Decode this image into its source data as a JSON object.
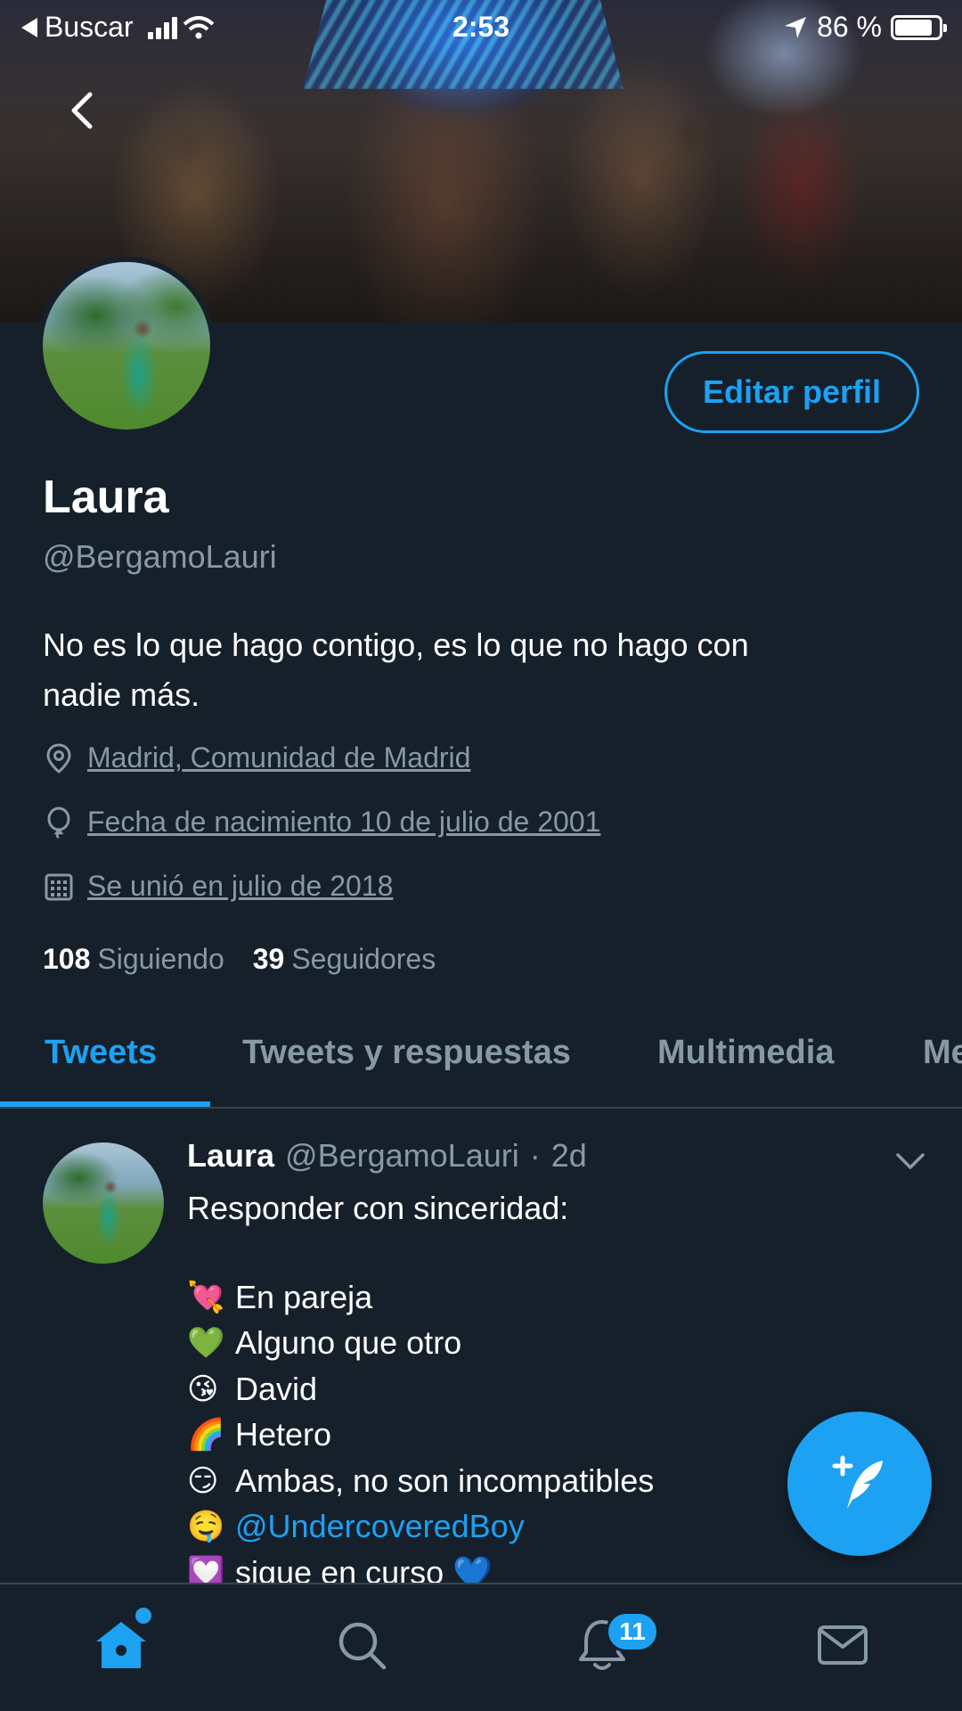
{
  "status_bar": {
    "back_app": "Buscar",
    "time": "2:53",
    "battery": "86 %",
    "battery_level": 0.86
  },
  "profile": {
    "edit_button": "Editar perfil",
    "name": "Laura",
    "handle": "@BergamoLauri",
    "bio_line1": "No es lo que hago contigo, es lo que no hago con",
    "bio_line2": "nadie más.",
    "location": "Madrid, Comunidad de Madrid",
    "birthday": "Fecha de nacimiento 10 de julio de 2001",
    "joined": "Se unió en julio de 2018",
    "following_count": "108",
    "following_label": "Siguiendo",
    "followers_count": "39",
    "followers_label": "Seguidores"
  },
  "tabs": [
    {
      "label": "Tweets",
      "active": true
    },
    {
      "label": "Tweets y respuestas",
      "active": false
    },
    {
      "label": "Multimedia",
      "active": false
    },
    {
      "label": "Me",
      "active": false
    }
  ],
  "tweet": {
    "name": "Laura",
    "handle": "@BergamoLauri",
    "dot": "·",
    "age": "2d",
    "text": "Responder con sinceridad:",
    "lines": [
      {
        "emoji": "💘",
        "text": "En pareja"
      },
      {
        "emoji": "💚",
        "text": "Alguno que otro"
      },
      {
        "emoji": "😘",
        "text": "David"
      },
      {
        "emoji": "🌈",
        "text": "Hetero"
      },
      {
        "emoji": "😏",
        "text": "Ambas, no son incompatibles"
      },
      {
        "emoji": "🤤",
        "text": "@UndercoveredBoy"
      },
      {
        "emoji": "💟",
        "text": "sigue en curso 💙"
      }
    ]
  },
  "bottom_nav": {
    "notifications_badge": "11",
    "items": [
      "home-icon",
      "search-icon",
      "notifications-icon",
      "messages-icon"
    ]
  },
  "colors": {
    "background": "#15202b",
    "accent": "#1da1f2",
    "secondary_text": "#8899a6",
    "divider": "#38444d"
  }
}
